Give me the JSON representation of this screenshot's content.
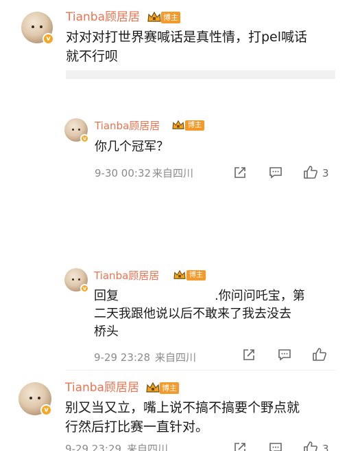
{
  "comments": [
    {
      "author": "Tianba顾居居",
      "tag": "博主",
      "text_line1": "对对对打世界赛喊话是真性情，打pel喊话",
      "text_line2": "就不行呗"
    },
    {
      "author": "Tianba顾居居",
      "tag": "博主",
      "text": "你几个冠军？",
      "time": "9-30 00:32",
      "location": "来自四川",
      "likes": "3"
    },
    {
      "author": "Tianba顾居居",
      "tag": "博主",
      "reply_prefix": "回复",
      "text_line1_tail": ".你问问吒宝，第",
      "text_line2": "二天我跟他说以后不敢来了我去没去",
      "text_line3": "桥头",
      "time": "9-29 23:28",
      "location": "来自四川"
    },
    {
      "author": "Tianba顾居居",
      "tag": "博主",
      "text_line1": "别又当又立，嘴上说不搞不搞要个野点就",
      "text_line2": "行然后打比赛一直针对。",
      "time": "9-29 23:29",
      "location": "来自四川",
      "likes": "3"
    }
  ],
  "icons": {
    "share": "share-icon",
    "comment": "comment-icon",
    "like": "thumbs-up-icon",
    "verified": "verified-v-icon",
    "crown": "crown-icon"
  },
  "colors": {
    "author_name": "#eb7350",
    "tag_bg": "#f39a2b",
    "verified_badge": "#f5a623"
  }
}
